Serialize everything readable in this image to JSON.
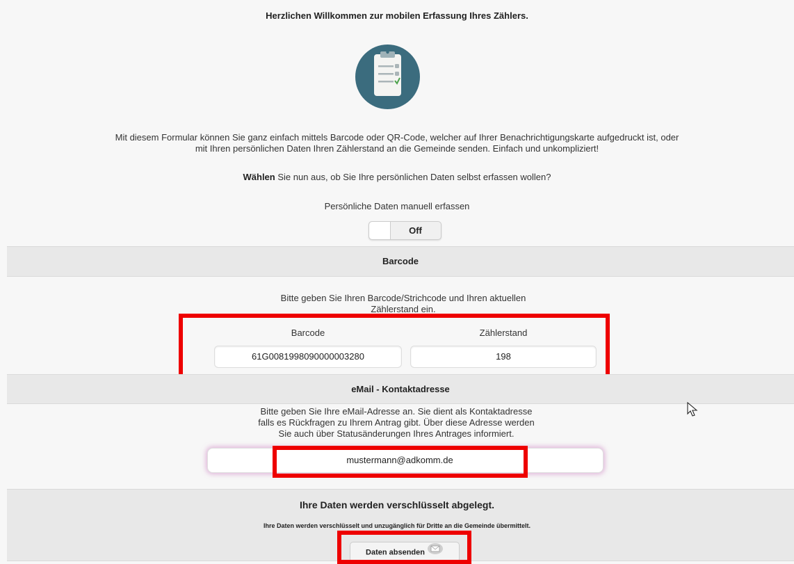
{
  "header": {
    "title": "Herzlichen Willkommen zur mobilen Erfassung Ihres Zählers."
  },
  "logo": {
    "icon": "clipboard-checklist-icon",
    "circle_color": "#3b6c7e"
  },
  "intro": {
    "line1": "Mit diesem Formular können Sie ganz einfach mittels Barcode oder QR-Code, welcher auf Ihrer Benachrichtigungskarte aufgedruckt ist, oder",
    "line2": "mit Ihren persönlichen Daten Ihren Zählerstand an die Gemeinde senden. Einfach und unkompliziert!"
  },
  "choose": {
    "bold": "Wählen",
    "rest": " Sie nun aus, ob Sie Ihre persönlichen Daten selbst erfassen wollen?"
  },
  "manual": {
    "label": "Persönliche Daten manuell erfassen",
    "toggle_state": "Off"
  },
  "barcode_section": {
    "title": "Barcode",
    "hint_line1": "Bitte geben Sie Ihren Barcode/Strichcode und Ihren aktuellen",
    "hint_line2": "Zählerstand ein.",
    "barcode_label": "Barcode",
    "barcode_value": "61G0081998090000003280",
    "meter_label": "Zählerstand",
    "meter_value": "198"
  },
  "email_section": {
    "title": "eMail - Kontaktadresse",
    "hint_line1": "Bitte geben Sie Ihre eMail-Adresse an. Sie dient als Kontaktadresse",
    "hint_line2": "falls es Rückfragen zu Ihrem Antrag gibt. Über diese Adresse werden",
    "hint_line3": "Sie auch über Statusänderungen Ihres Antrages informiert.",
    "email_value": "mustermann@adkomm.de"
  },
  "footer": {
    "title": "Ihre Daten werden verschlüsselt abgelegt.",
    "note": "Ihre Daten werden verschlüsselt und unzugänglich für Dritte an die Gemeinde übermittelt.",
    "submit_label": "Daten absenden",
    "submit_icon": "envelope-icon"
  },
  "colors": {
    "highlight": "#ee0000",
    "section_bar": "#e8e8e8",
    "email_glow": "#cd82c3"
  }
}
